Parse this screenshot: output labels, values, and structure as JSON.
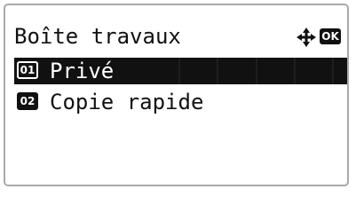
{
  "header": {
    "title": "Boîte travaux",
    "nav_icon": "four-way-arrows-icon",
    "ok_label": "OK"
  },
  "menu": {
    "items": [
      {
        "number": "01",
        "label": "Privé",
        "selected": true
      },
      {
        "number": "02",
        "label": "Copie rapide",
        "selected": false
      }
    ]
  },
  "colors": {
    "text": "#111111",
    "background": "#ffffff",
    "selection": "#111111",
    "bezel": "#a9a9a9"
  }
}
